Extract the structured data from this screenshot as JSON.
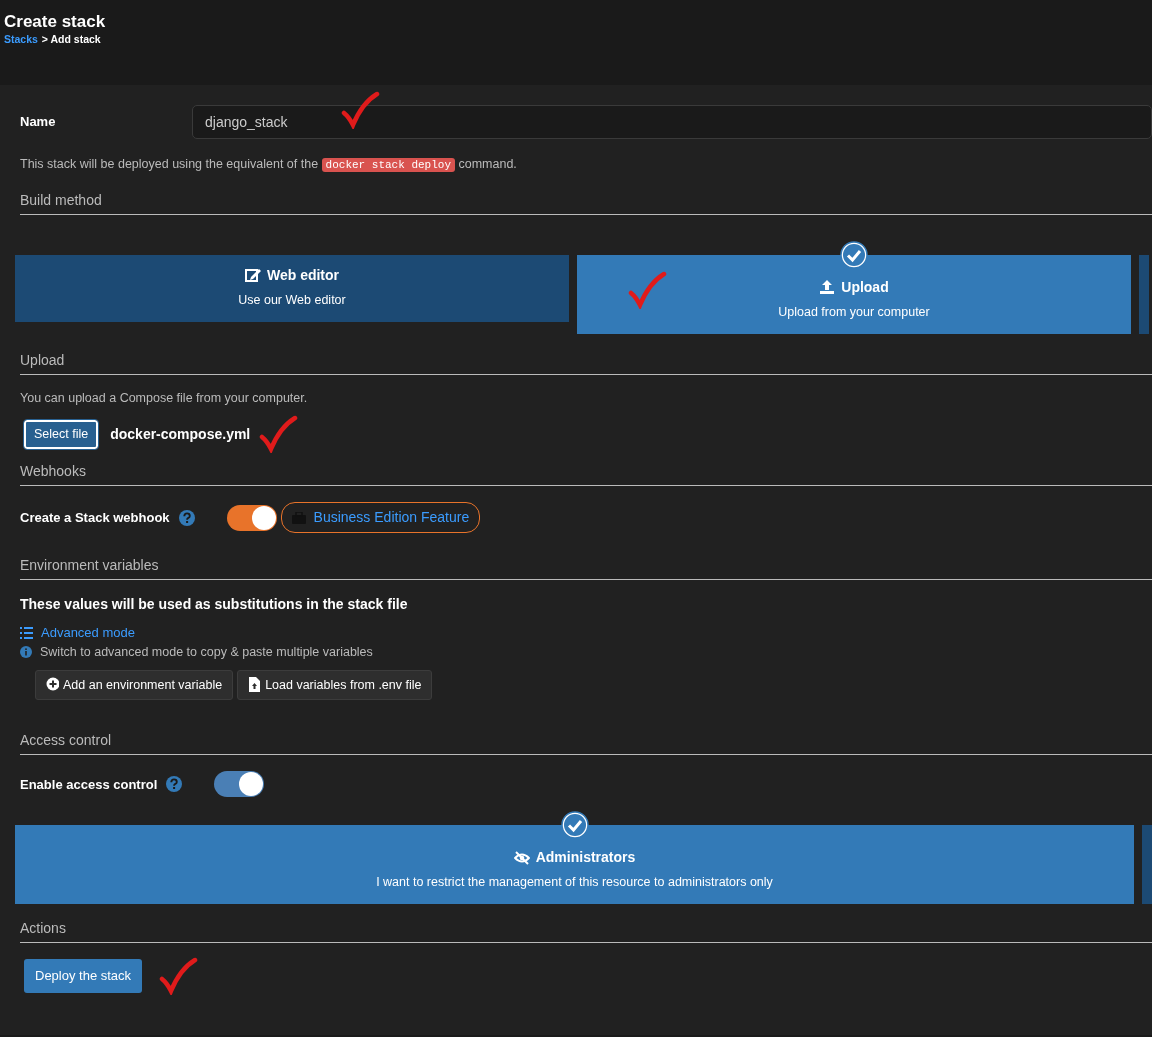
{
  "header": {
    "title": "Create stack",
    "breadcrumb": [
      {
        "label": "Stacks",
        "kind": "link"
      },
      {
        "label": "> Add stack",
        "kind": "text"
      }
    ]
  },
  "name_field": {
    "label": "Name",
    "value": "django_stack"
  },
  "deploy_note": {
    "before": "This stack will be deployed using the equivalent of the",
    "code": "docker stack deploy",
    "after": "command."
  },
  "build_method": {
    "heading": "Build method",
    "options": [
      {
        "title": "Web editor",
        "description": "Use our Web editor",
        "kind": "edit",
        "selected": false
      },
      {
        "title": "Upload",
        "description": "Upload from your computer",
        "kind": "upload",
        "selected": true
      }
    ]
  },
  "upload": {
    "heading": "Upload",
    "note": "You can upload a Compose file from your computer.",
    "button": "Select file",
    "file_name": "docker-compose.yml"
  },
  "webhooks": {
    "heading": "Webhooks",
    "label": "Create a Stack webhook",
    "on": true,
    "badge": "Business Edition Feature"
  },
  "environment": {
    "heading": "Environment variables",
    "intro": "These values will be used as substitutions in the stack file",
    "link": "Advanced mode",
    "hint": "Switch to advanced mode to copy & paste multiple variables",
    "buttons": [
      {
        "label": "Add an environment variable",
        "kind": "add"
      },
      {
        "label": "Load variables from .env file",
        "kind": "file"
      }
    ]
  },
  "access_control": {
    "heading": "Access control",
    "label": "Enable access control",
    "on": true,
    "options": [
      {
        "title": "Administrators",
        "description": "I want to restrict the management of this resource to administrators only",
        "kind": "admin",
        "selected": true
      }
    ]
  },
  "actions": {
    "heading": "Actions",
    "button": "Deploy the stack"
  }
}
